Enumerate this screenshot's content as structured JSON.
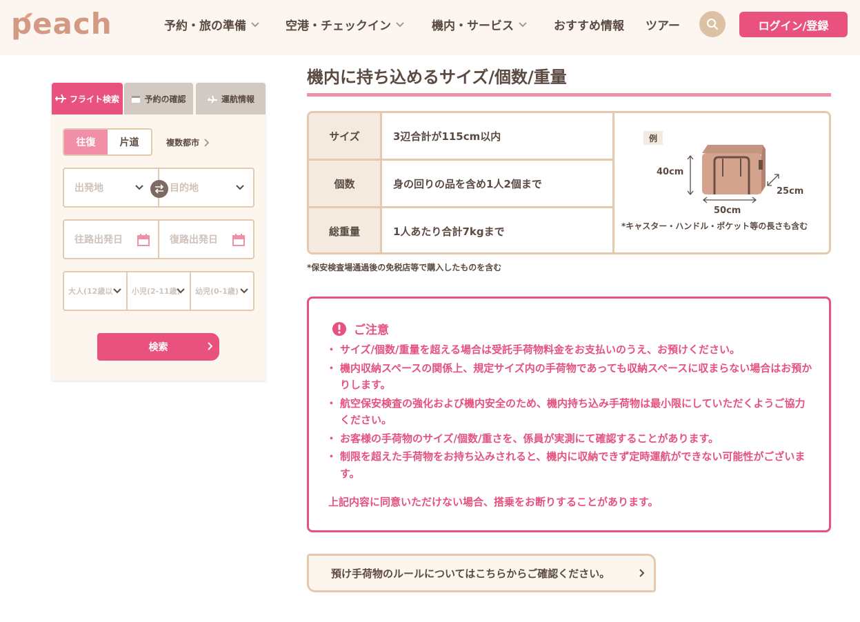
{
  "brand": {
    "logo_text": "peach",
    "accent": "#e9517f",
    "beige": "#e5c9ae",
    "brown": "#5a4a42"
  },
  "header": {
    "nav": [
      {
        "label": "予約・旅の準備",
        "has_dropdown": true
      },
      {
        "label": "空港・チェックイン",
        "has_dropdown": true
      },
      {
        "label": "機内・サービス",
        "has_dropdown": true
      },
      {
        "label": "おすすめ情報",
        "has_dropdown": false
      },
      {
        "label": "ツアー",
        "has_dropdown": false
      }
    ],
    "search_icon": "search-icon",
    "login_label": "ログイン/登録"
  },
  "sidebar": {
    "tabs": [
      {
        "label": "フライト検索",
        "icon": "airplane-icon",
        "active": true
      },
      {
        "label": "予約の確認",
        "icon": "calendar-icon",
        "active": false
      },
      {
        "label": "運航情報",
        "icon": "airplane-landing-icon",
        "active": false
      }
    ],
    "trip_round": "往復",
    "trip_oneway": "片道",
    "multi_city": "複数都市",
    "origin_placeholder": "出発地",
    "destination_placeholder": "目的地",
    "depart_date_placeholder": "往路出発日",
    "return_date_placeholder": "復路出発日",
    "adults": "大人(12歳以",
    "children": "小児(2-11歳)",
    "infants": "幼児(0-1歳)",
    "search_label": "検索"
  },
  "main": {
    "title": "機内に持ち込めるサイズ/個数/重量",
    "specs": [
      {
        "key": "サイズ",
        "value": "3辺合計が115cm以内"
      },
      {
        "key": "個数",
        "value": "身の回りの品を含め1人2個まで"
      },
      {
        "key": "総重量",
        "value": "1人あたり合計7kgまで"
      }
    ],
    "example": {
      "tag": "例",
      "height": "40cm",
      "width": "50cm",
      "depth": "25cm",
      "note": "*キャスター・ハンドル・ポケット等の長さも含む"
    },
    "duty_free_note": "*保安検査場通過後の免税店等で購入したものを含む",
    "caution": {
      "title": "ご注意",
      "items": [
        "サイズ/個数/重量を超える場合は受託手荷物料金をお支払いのうえ、お預けください。",
        "機内収納スペースの関係上、規定サイズ内の手荷物であっても収納スペースに収まらない場合はお預かりします。",
        "航空保安検査の強化および機内安全のため、機内持ち込み手荷物は最小限にしていただくようご協力ください。",
        "お客様の手荷物のサイズ/個数/重さを、係員が実測にて確認することがあります。",
        "制限を超えた手荷物をお持ち込みされると、機内に収納できず定時運航ができない可能性がございます。"
      ],
      "footer": "上記内容に同意いただけない場合、搭乗をお断りすることがあります。"
    },
    "rules_link": "預け手荷物のルールについてはこちらからご確認ください。"
  }
}
